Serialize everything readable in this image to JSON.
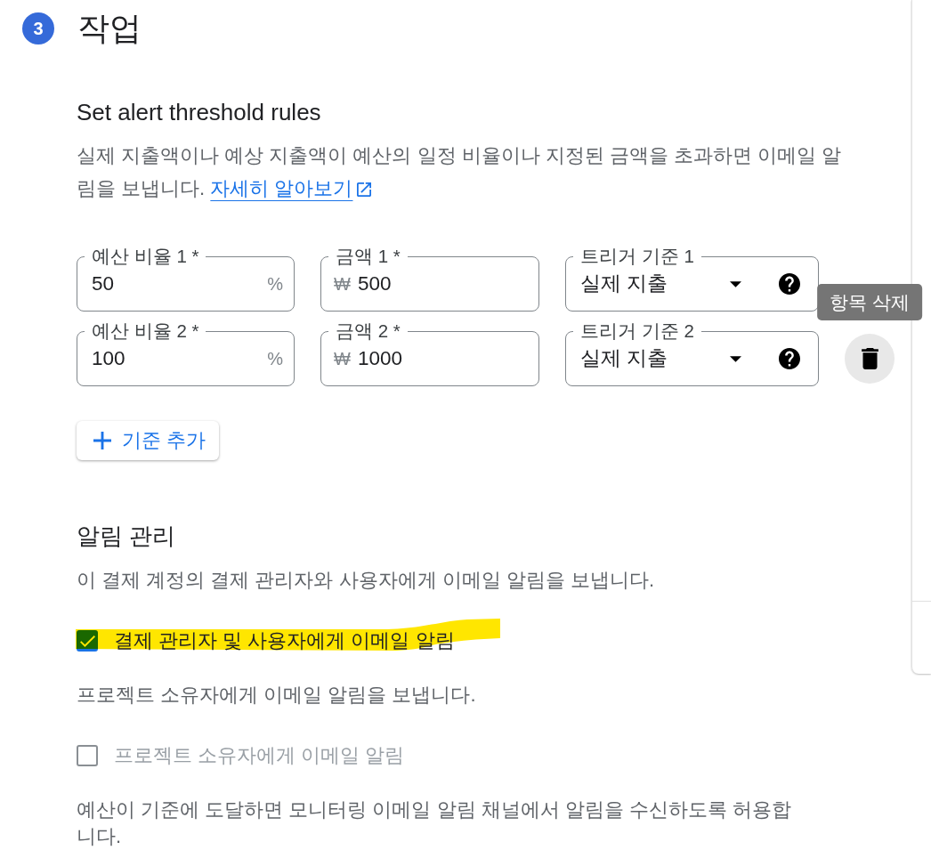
{
  "step": {
    "number": "3",
    "title": "작업"
  },
  "threshold": {
    "heading": "Set alert threshold rules",
    "description": "실제 지출액이나 예상 지출액이 예산의 일정 비율이나 지정된 금액을 초과하면 이메일 알림을 보냅니다.",
    "link": "자세히 알아보기"
  },
  "rules": [
    {
      "percent_label": "예산 비율 1 *",
      "percent_value": "50",
      "percent_suffix": "%",
      "amount_label": "금액 1 *",
      "amount_prefix": "₩",
      "amount_value": "500",
      "trigger_label": "트리거 기준 1",
      "trigger_value": "실제 지출",
      "deletable": false
    },
    {
      "percent_label": "예산 비율 2 *",
      "percent_value": "100",
      "percent_suffix": "%",
      "amount_label": "금액 2 *",
      "amount_prefix": "₩",
      "amount_value": "1000",
      "trigger_label": "트리거 기준 2",
      "trigger_value": "실제 지출",
      "deletable": true,
      "delete_tooltip": "항목 삭제"
    }
  ],
  "add_button": {
    "label": "기준 추가"
  },
  "notifications": {
    "heading": "알림 관리",
    "items": [
      {
        "kind": "paragraph",
        "text": "이 결제 계정의 결제 관리자와 사용자에게 이메일 알림을 보냅니다."
      },
      {
        "kind": "checkbox",
        "label": "결제 관리자 및 사용자에게 이메일 알림",
        "checked": true,
        "disabled": false,
        "highlighted": true
      },
      {
        "kind": "paragraph",
        "text": "프로젝트 소유자에게 이메일 알림을 보냅니다."
      },
      {
        "kind": "checkbox",
        "label": "프로젝트 소유자에게 이메일 알림",
        "checked": false,
        "disabled": true,
        "highlighted": false
      },
      {
        "kind": "paragraph",
        "text": "예산이 기준에 도달하면 모니터링 이메일 알림 채널에서 알림을 수신하도록 허용합니다."
      }
    ]
  }
}
